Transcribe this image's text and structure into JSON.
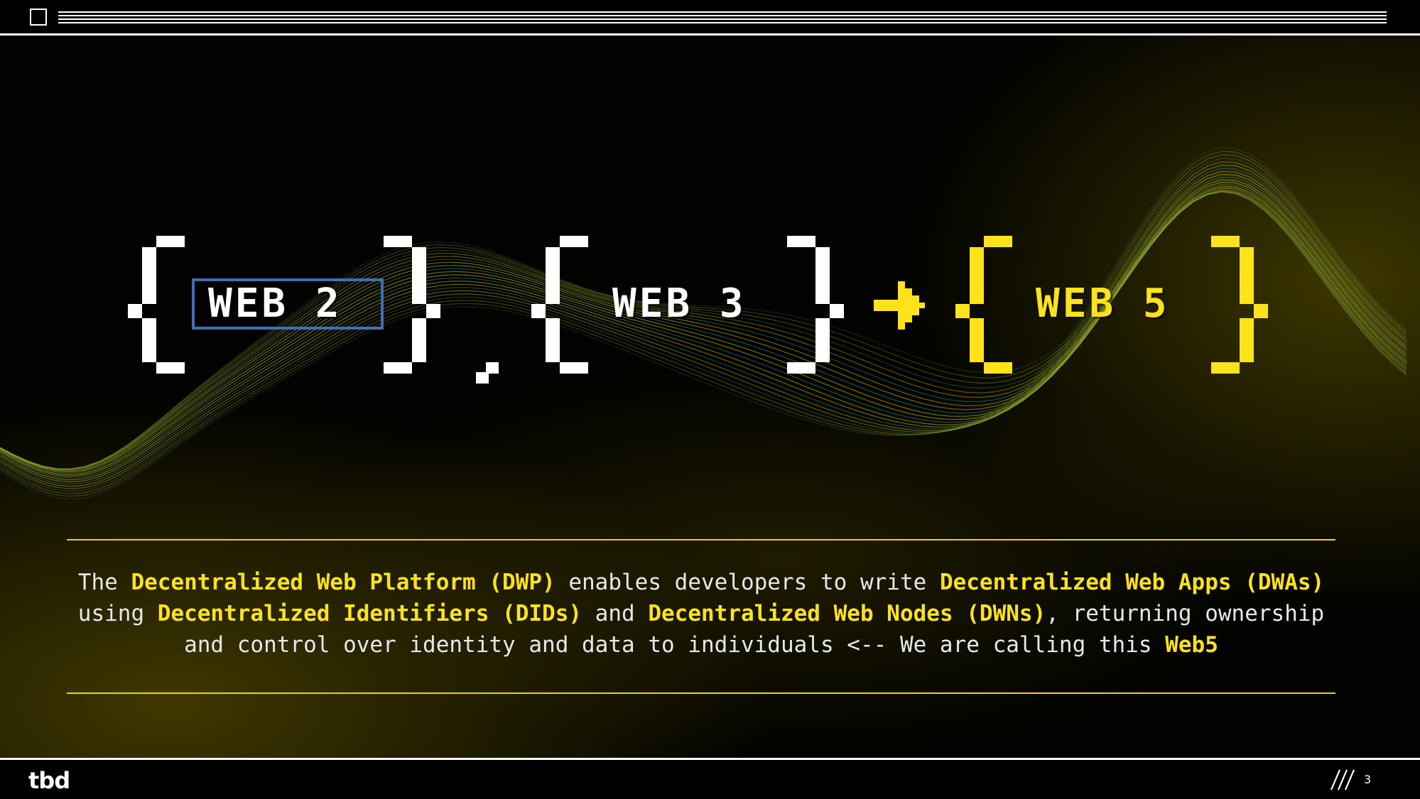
{
  "footer": {
    "logo": "tbd",
    "page_number": "3"
  },
  "hero": {
    "items": [
      "WEB 2",
      "WEB 3",
      "WEB 5"
    ],
    "separator": ",",
    "arrow_icon": "arrow-right-icon"
  },
  "description": {
    "line1_a": "The ",
    "line1_b": "Decentralized Web Platform (DWP)",
    "line1_c": " enables developers to write ",
    "line1_d": "Decentralized Web Apps (DWAs)",
    "line2_a": "using ",
    "line2_b": "Decentralized Identifiers (DIDs)",
    "line2_c": " and ",
    "line2_d": "Decentralized Web Nodes (DWNs)",
    "line2_e": ", returning ownership",
    "line3_a": "and control over identity and data to individuals <-- We are calling this ",
    "line3_b": "Web5"
  },
  "colors": {
    "accent": "#ffe31a",
    "web2_outline": "#3f6fb4",
    "wave": "#c8b400",
    "wave_alt": "#1a8a8a"
  }
}
